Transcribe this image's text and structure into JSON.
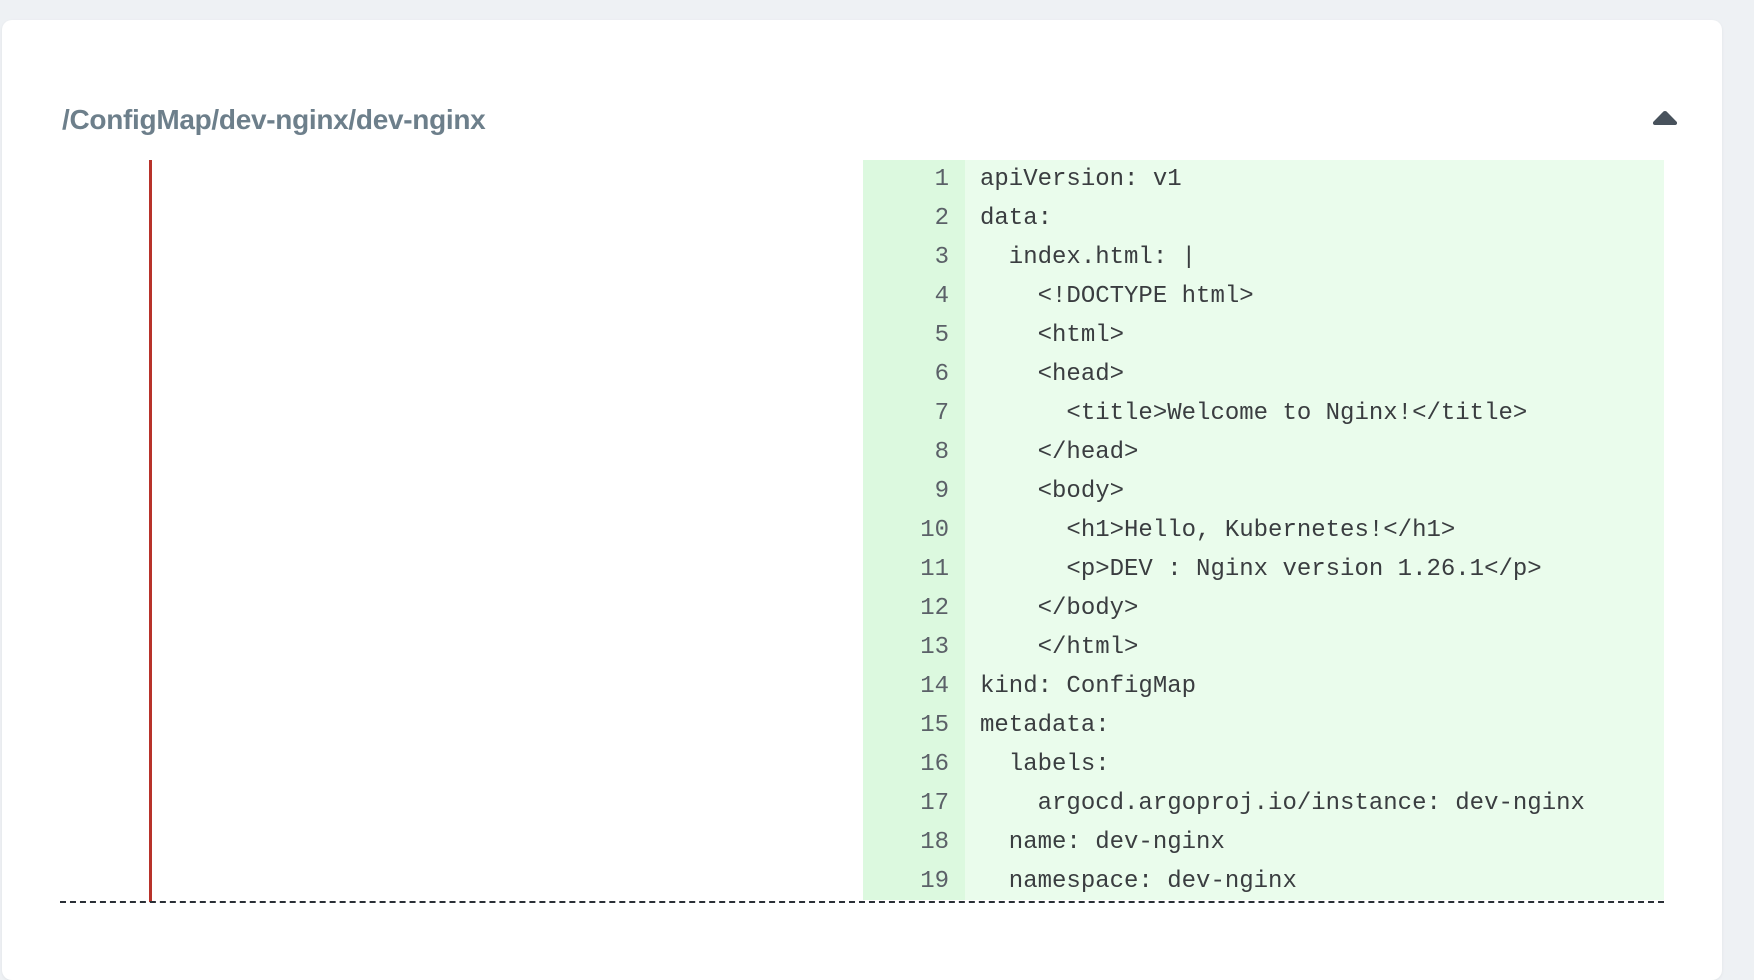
{
  "panel": {
    "title": "/ConfigMap/dev-nginx/dev-nginx",
    "collapse_icon": "caret-up-icon"
  },
  "colors": {
    "removed_marker": "#b8322a",
    "added_background": "#eafcec",
    "added_gutter": "#dcf9df",
    "title_text": "#6d7f8b"
  },
  "diff": {
    "right_lines": [
      {
        "num": "1",
        "code": "apiVersion: v1"
      },
      {
        "num": "2",
        "code": "data:"
      },
      {
        "num": "3",
        "code": "  index.html: |"
      },
      {
        "num": "4",
        "code": "    <!DOCTYPE html>"
      },
      {
        "num": "5",
        "code": "    <html>"
      },
      {
        "num": "6",
        "code": "    <head>"
      },
      {
        "num": "7",
        "code": "      <title>Welcome to Nginx!</title>"
      },
      {
        "num": "8",
        "code": "    </head>"
      },
      {
        "num": "9",
        "code": "    <body>"
      },
      {
        "num": "10",
        "code": "      <h1>Hello, Kubernetes!</h1>"
      },
      {
        "num": "11",
        "code": "      <p>DEV : Nginx version 1.26.1</p>"
      },
      {
        "num": "12",
        "code": "    </body>"
      },
      {
        "num": "13",
        "code": "    </html>"
      },
      {
        "num": "14",
        "code": "kind: ConfigMap"
      },
      {
        "num": "15",
        "code": "metadata:"
      },
      {
        "num": "16",
        "code": "  labels:"
      },
      {
        "num": "17",
        "code": "    argocd.argoproj.io/instance: dev-nginx"
      },
      {
        "num": "18",
        "code": "  name: dev-nginx"
      },
      {
        "num": "19",
        "code": "  namespace: dev-nginx"
      }
    ]
  }
}
